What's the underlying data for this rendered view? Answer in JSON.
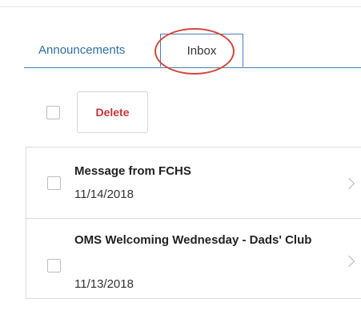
{
  "tabs": {
    "announcements": "Announcements",
    "inbox": "Inbox"
  },
  "toolbar": {
    "delete_label": "Delete"
  },
  "messages": [
    {
      "title": "Message from FCHS",
      "date": "11/14/2018"
    },
    {
      "title": "OMS Welcoming Wednesday - Dads' Club",
      "date": "11/13/2018"
    }
  ],
  "colors": {
    "accent": "#2f6ea5",
    "delete": "#c6343a",
    "highlight": "#d6463a"
  },
  "icons": [
    "checkbox-icon",
    "chevron-right-icon"
  ]
}
